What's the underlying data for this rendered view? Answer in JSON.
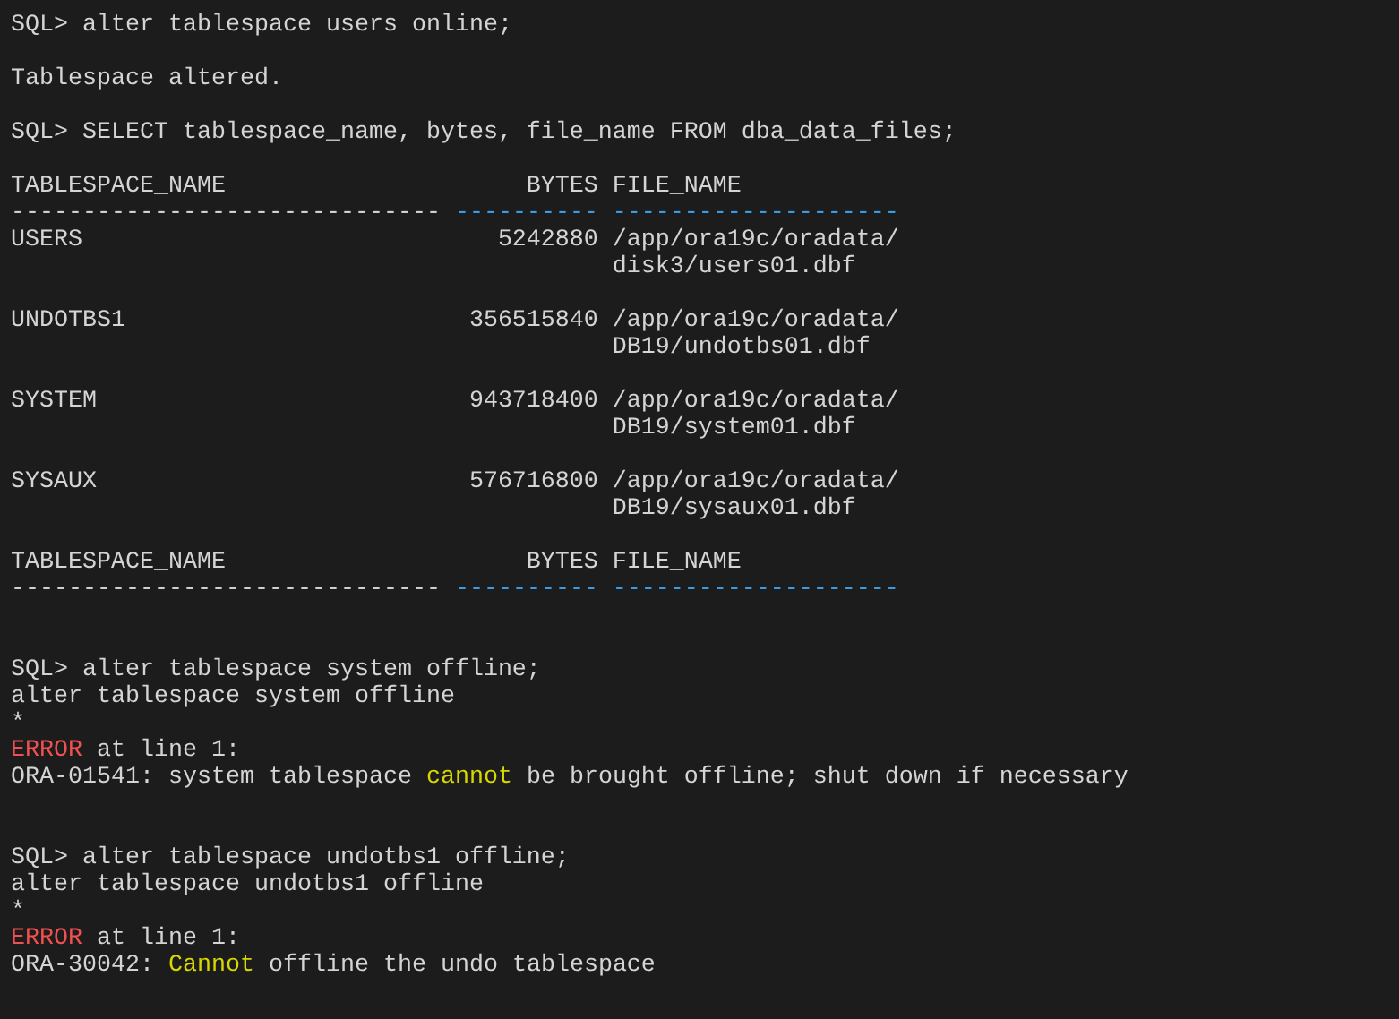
{
  "terminal": {
    "lines": [
      {
        "kind": "text",
        "segments": [
          {
            "text": "SQL> alter tablespace users online;",
            "kind": "plain"
          }
        ]
      },
      {
        "kind": "blank"
      },
      {
        "kind": "text",
        "segments": [
          {
            "text": "Tablespace altered.",
            "kind": "plain"
          }
        ]
      },
      {
        "kind": "blank"
      },
      {
        "kind": "text",
        "segments": [
          {
            "text": "SQL> SELECT tablespace_name, bytes, file_name FROM dba_data_files;",
            "kind": "plain"
          }
        ]
      },
      {
        "kind": "blank"
      },
      {
        "kind": "text",
        "segments": [
          {
            "text": "TABLESPACE_NAME                     BYTES FILE_NAME",
            "kind": "plain"
          }
        ]
      },
      {
        "kind": "text",
        "segments": [
          {
            "text": "------------------------------ ",
            "kind": "plain"
          },
          {
            "text": "---------- --------------------",
            "kind": "rule"
          }
        ]
      },
      {
        "kind": "text",
        "segments": [
          {
            "text": "USERS                             5242880 /app/ora19c/oradata/",
            "kind": "plain"
          }
        ]
      },
      {
        "kind": "text",
        "segments": [
          {
            "text": "                                          disk3/users01.dbf",
            "kind": "plain"
          }
        ]
      },
      {
        "kind": "blank"
      },
      {
        "kind": "text",
        "segments": [
          {
            "text": "UNDOTBS1                        356515840 /app/ora19c/oradata/",
            "kind": "plain"
          }
        ]
      },
      {
        "kind": "text",
        "segments": [
          {
            "text": "                                          DB19/undotbs01.dbf",
            "kind": "plain"
          }
        ]
      },
      {
        "kind": "blank"
      },
      {
        "kind": "text",
        "segments": [
          {
            "text": "SYSTEM                          943718400 /app/ora19c/oradata/",
            "kind": "plain"
          }
        ]
      },
      {
        "kind": "text",
        "segments": [
          {
            "text": "                                          DB19/system01.dbf",
            "kind": "plain"
          }
        ]
      },
      {
        "kind": "blank"
      },
      {
        "kind": "text",
        "segments": [
          {
            "text": "SYSAUX                          576716800 /app/ora19c/oradata/",
            "kind": "plain"
          }
        ]
      },
      {
        "kind": "text",
        "segments": [
          {
            "text": "                                          DB19/sysaux01.dbf",
            "kind": "plain"
          }
        ]
      },
      {
        "kind": "blank"
      },
      {
        "kind": "text",
        "segments": [
          {
            "text": "TABLESPACE_NAME                     BYTES FILE_NAME",
            "kind": "plain"
          }
        ]
      },
      {
        "kind": "text",
        "segments": [
          {
            "text": "------------------------------ ",
            "kind": "plain"
          },
          {
            "text": "---------- --------------------",
            "kind": "rule"
          }
        ]
      },
      {
        "kind": "blank"
      },
      {
        "kind": "blank"
      },
      {
        "kind": "text",
        "segments": [
          {
            "text": "SQL> alter tablespace system offline;",
            "kind": "plain"
          }
        ]
      },
      {
        "kind": "text",
        "segments": [
          {
            "text": "alter tablespace system offline",
            "kind": "plain"
          }
        ]
      },
      {
        "kind": "text",
        "segments": [
          {
            "text": "*",
            "kind": "plain"
          }
        ]
      },
      {
        "kind": "text",
        "segments": [
          {
            "text": "ERROR",
            "kind": "error"
          },
          {
            "text": " at line 1:",
            "kind": "plain"
          }
        ]
      },
      {
        "kind": "text",
        "segments": [
          {
            "text": "ORA-01541: system tablespace ",
            "kind": "plain"
          },
          {
            "text": "cannot",
            "kind": "keyword"
          },
          {
            "text": " be brought offline; shut down if necessary",
            "kind": "plain"
          }
        ]
      },
      {
        "kind": "blank"
      },
      {
        "kind": "blank"
      },
      {
        "kind": "text",
        "segments": [
          {
            "text": "SQL> alter tablespace undotbs1 offline;",
            "kind": "plain"
          }
        ]
      },
      {
        "kind": "text",
        "segments": [
          {
            "text": "alter tablespace undotbs1 offline",
            "kind": "plain"
          }
        ]
      },
      {
        "kind": "text",
        "segments": [
          {
            "text": "*",
            "kind": "plain"
          }
        ]
      },
      {
        "kind": "text",
        "segments": [
          {
            "text": "ERROR",
            "kind": "error"
          },
          {
            "text": " at line 1:",
            "kind": "plain"
          }
        ]
      },
      {
        "kind": "text",
        "segments": [
          {
            "text": "ORA-30042: ",
            "kind": "plain"
          },
          {
            "text": "Cannot",
            "kind": "keyword"
          },
          {
            "text": " offline the undo tablespace",
            "kind": "plain"
          }
        ]
      }
    ]
  }
}
